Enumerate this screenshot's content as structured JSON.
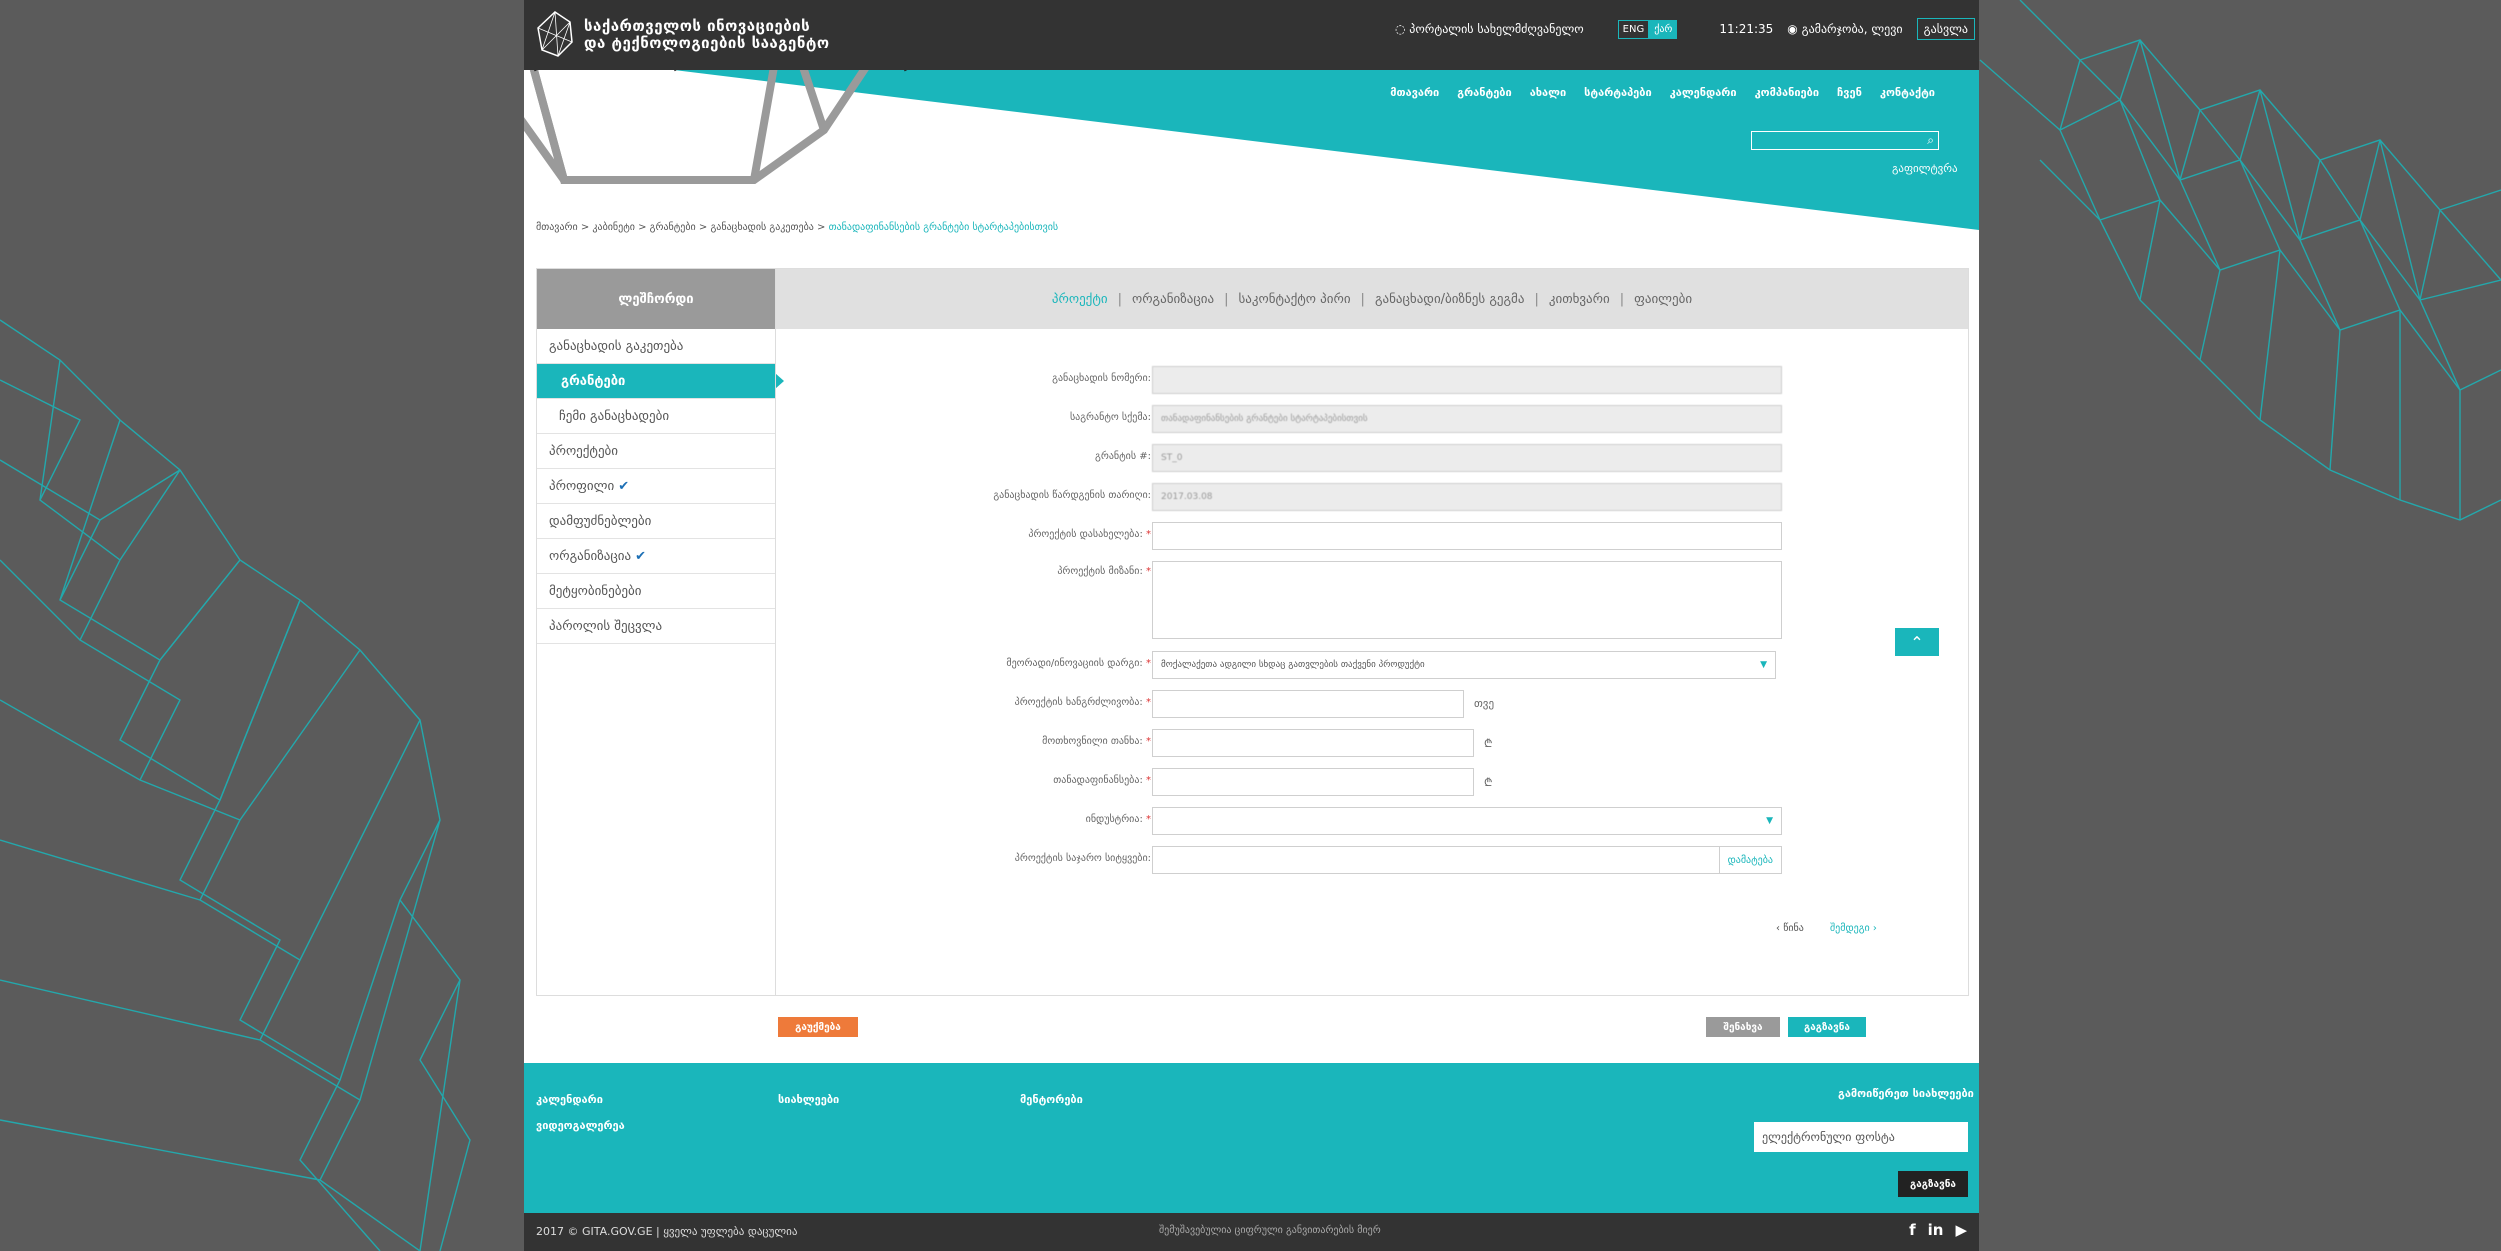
{
  "header": {
    "logo_line1": "საქართველოს ინოვაციების",
    "logo_line2": "და ტექნოლოგიების სააგენტო",
    "portal_label": "პორტალის სახელმძღვანელო",
    "lang_eng": "ENG",
    "lang_geo": "ქარ",
    "clock": "11:21:35",
    "greeting": "გამარჯობა, ლევი",
    "exit_label": "გასვლა"
  },
  "nav": {
    "items": [
      "მთავარი",
      "გრანტები",
      "ახალი",
      "სტარტაპები",
      "კალენდარი",
      "კომპანიები",
      "ჩვენ",
      "კონტაქტი"
    ],
    "advanced_search": "გაფილტვრა"
  },
  "breadcrumb": {
    "path": "მთავარი > კაბინეტი > გრანტები > განაცხადის გაკეთება > ",
    "current": "თანადაფინანსების გრანტები სტარტაპებისთვის"
  },
  "sidebar": {
    "title": "ლეშჩორდი",
    "items": [
      {
        "label": "განაცხადის გაკეთება"
      },
      {
        "label": "გრანტები"
      },
      {
        "label": "ჩემი განაცხადები"
      },
      {
        "label": "პროექტები"
      },
      {
        "label": "პროფილი"
      },
      {
        "label": "დამფუძნებლები"
      },
      {
        "label": "ორგანიზაცია"
      },
      {
        "label": "მეტყობინებები"
      },
      {
        "label": "პაროლის შეცვლა"
      }
    ],
    "check_mark": "✔"
  },
  "tabs": [
    "პროექტი",
    "ორგანიზაცია",
    "საკონტაქტო პირი",
    "განაცხადი/ბიზნეს გეგმა",
    "კითხვარი",
    "ფაილები"
  ],
  "form": {
    "fields": [
      {
        "label": "განაცხადის ნომერი:",
        "value": ""
      },
      {
        "label": "საგრანტო სქემა:",
        "value": "თანადაფინანსების გრანტები სტარტაპებისთვის"
      },
      {
        "label": "გრანტის #:",
        "value": "ST_0"
      },
      {
        "label": "განაცხადის წარდგენის თარიღი:",
        "value": "2017.03.08"
      },
      {
        "label": "პროექტის დასახელება:",
        "value": ""
      },
      {
        "label": "პროექტის მიზანი:",
        "value": ""
      },
      {
        "label": "მეორადი/ინოვაციის დარგი:",
        "value": "მოქალაქეთა ადგილი სხდაც გათვლების თაქვენი პროდუქტი"
      },
      {
        "label": "პროექტის ხანგრძლივობა:",
        "value": "",
        "unit": "თვე"
      },
      {
        "label": "მოთხოვნილი თანხა:",
        "value": "",
        "unit": "₾"
      },
      {
        "label": "თანადაფინანსება:",
        "value": "",
        "unit": "₾"
      },
      {
        "label": "ინდუსტრია:",
        "value": ""
      },
      {
        "label": "პროექტის საჯარო სიტყვები:",
        "value": "",
        "button": "დამატება"
      }
    ],
    "required_mark": "*",
    "prev_label": "წინა",
    "next_label": "შემდეგი"
  },
  "actions": {
    "cancel": "გაუქმება",
    "save": "შენახვა",
    "submit": "გაგზავნა"
  },
  "footer": {
    "links": [
      "კალენდარი",
      "სიახლეები",
      "მენტორები",
      "ვიდეოგალერეა"
    ],
    "subscribe_title": "გამოიწერეთ სიახლეები",
    "email_placeholder": "ელექტრონული ფოსტა",
    "subscribe_button": "გაგზავნა",
    "copyright": "2017 © GITA.GOV.GE | ყველა უფლება დაცულია",
    "center_note": "შემუშავებულია ციფრული განვითარების მიერ"
  }
}
